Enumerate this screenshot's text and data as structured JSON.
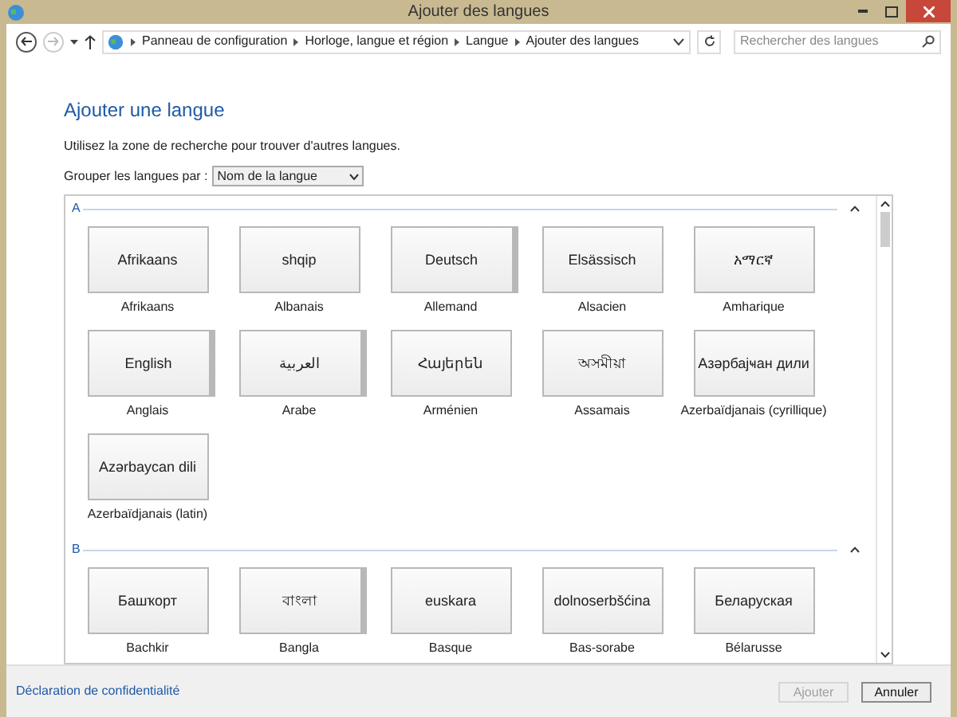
{
  "window": {
    "title": "Ajouter des langues"
  },
  "breadcrumb": [
    "Panneau de configuration",
    "Horloge, langue et région",
    "Langue",
    "Ajouter des langues"
  ],
  "search": {
    "placeholder": "Rechercher des langues"
  },
  "heading": "Ajouter une langue",
  "hint": "Utilisez la zone de recherche pour trouver d'autres langues.",
  "group_by": {
    "label": "Grouper les langues par :",
    "value": "Nom de la langue"
  },
  "groups": [
    {
      "letter": "A",
      "languages": [
        {
          "native": "Afrikaans",
          "name": "Afrikaans",
          "stacked": false
        },
        {
          "native": "shqip",
          "name": "Albanais",
          "stacked": false
        },
        {
          "native": "Deutsch",
          "name": "Allemand",
          "stacked": true
        },
        {
          "native": "Elsässisch",
          "name": "Alsacien",
          "stacked": false
        },
        {
          "native": "አማርኛ",
          "name": "Amharique",
          "stacked": false
        },
        {
          "native": "English",
          "name": "Anglais",
          "stacked": true
        },
        {
          "native": "العربية",
          "name": "Arabe",
          "stacked": true
        },
        {
          "native": "Հայերեն",
          "name": "Arménien",
          "stacked": false
        },
        {
          "native": "অসমীয়া",
          "name": "Assamais",
          "stacked": false
        },
        {
          "native": "Азәрбајҹан дили",
          "name": "Azerbaïdjanais (cyrillique)",
          "stacked": false
        },
        {
          "native": "Azərbaycan dili",
          "name": "Azerbaïdjanais (latin)",
          "stacked": false
        }
      ]
    },
    {
      "letter": "B",
      "languages": [
        {
          "native": "Башҡорт",
          "name": "Bachkir",
          "stacked": false
        },
        {
          "native": "বাংলা",
          "name": "Bangla",
          "stacked": true
        },
        {
          "native": "euskara",
          "name": "Basque",
          "stacked": false
        },
        {
          "native": "dolnoserbšćina",
          "name": "Bas-sorabe",
          "stacked": false
        },
        {
          "native": "Беларуская",
          "name": "Bélarusse",
          "stacked": false
        }
      ]
    }
  ],
  "footer": {
    "link": "Déclaration de confidentialité",
    "buttons": [
      {
        "label": "Ajouter",
        "disabled": true
      },
      {
        "label": "Annuler",
        "disabled": false
      }
    ]
  }
}
